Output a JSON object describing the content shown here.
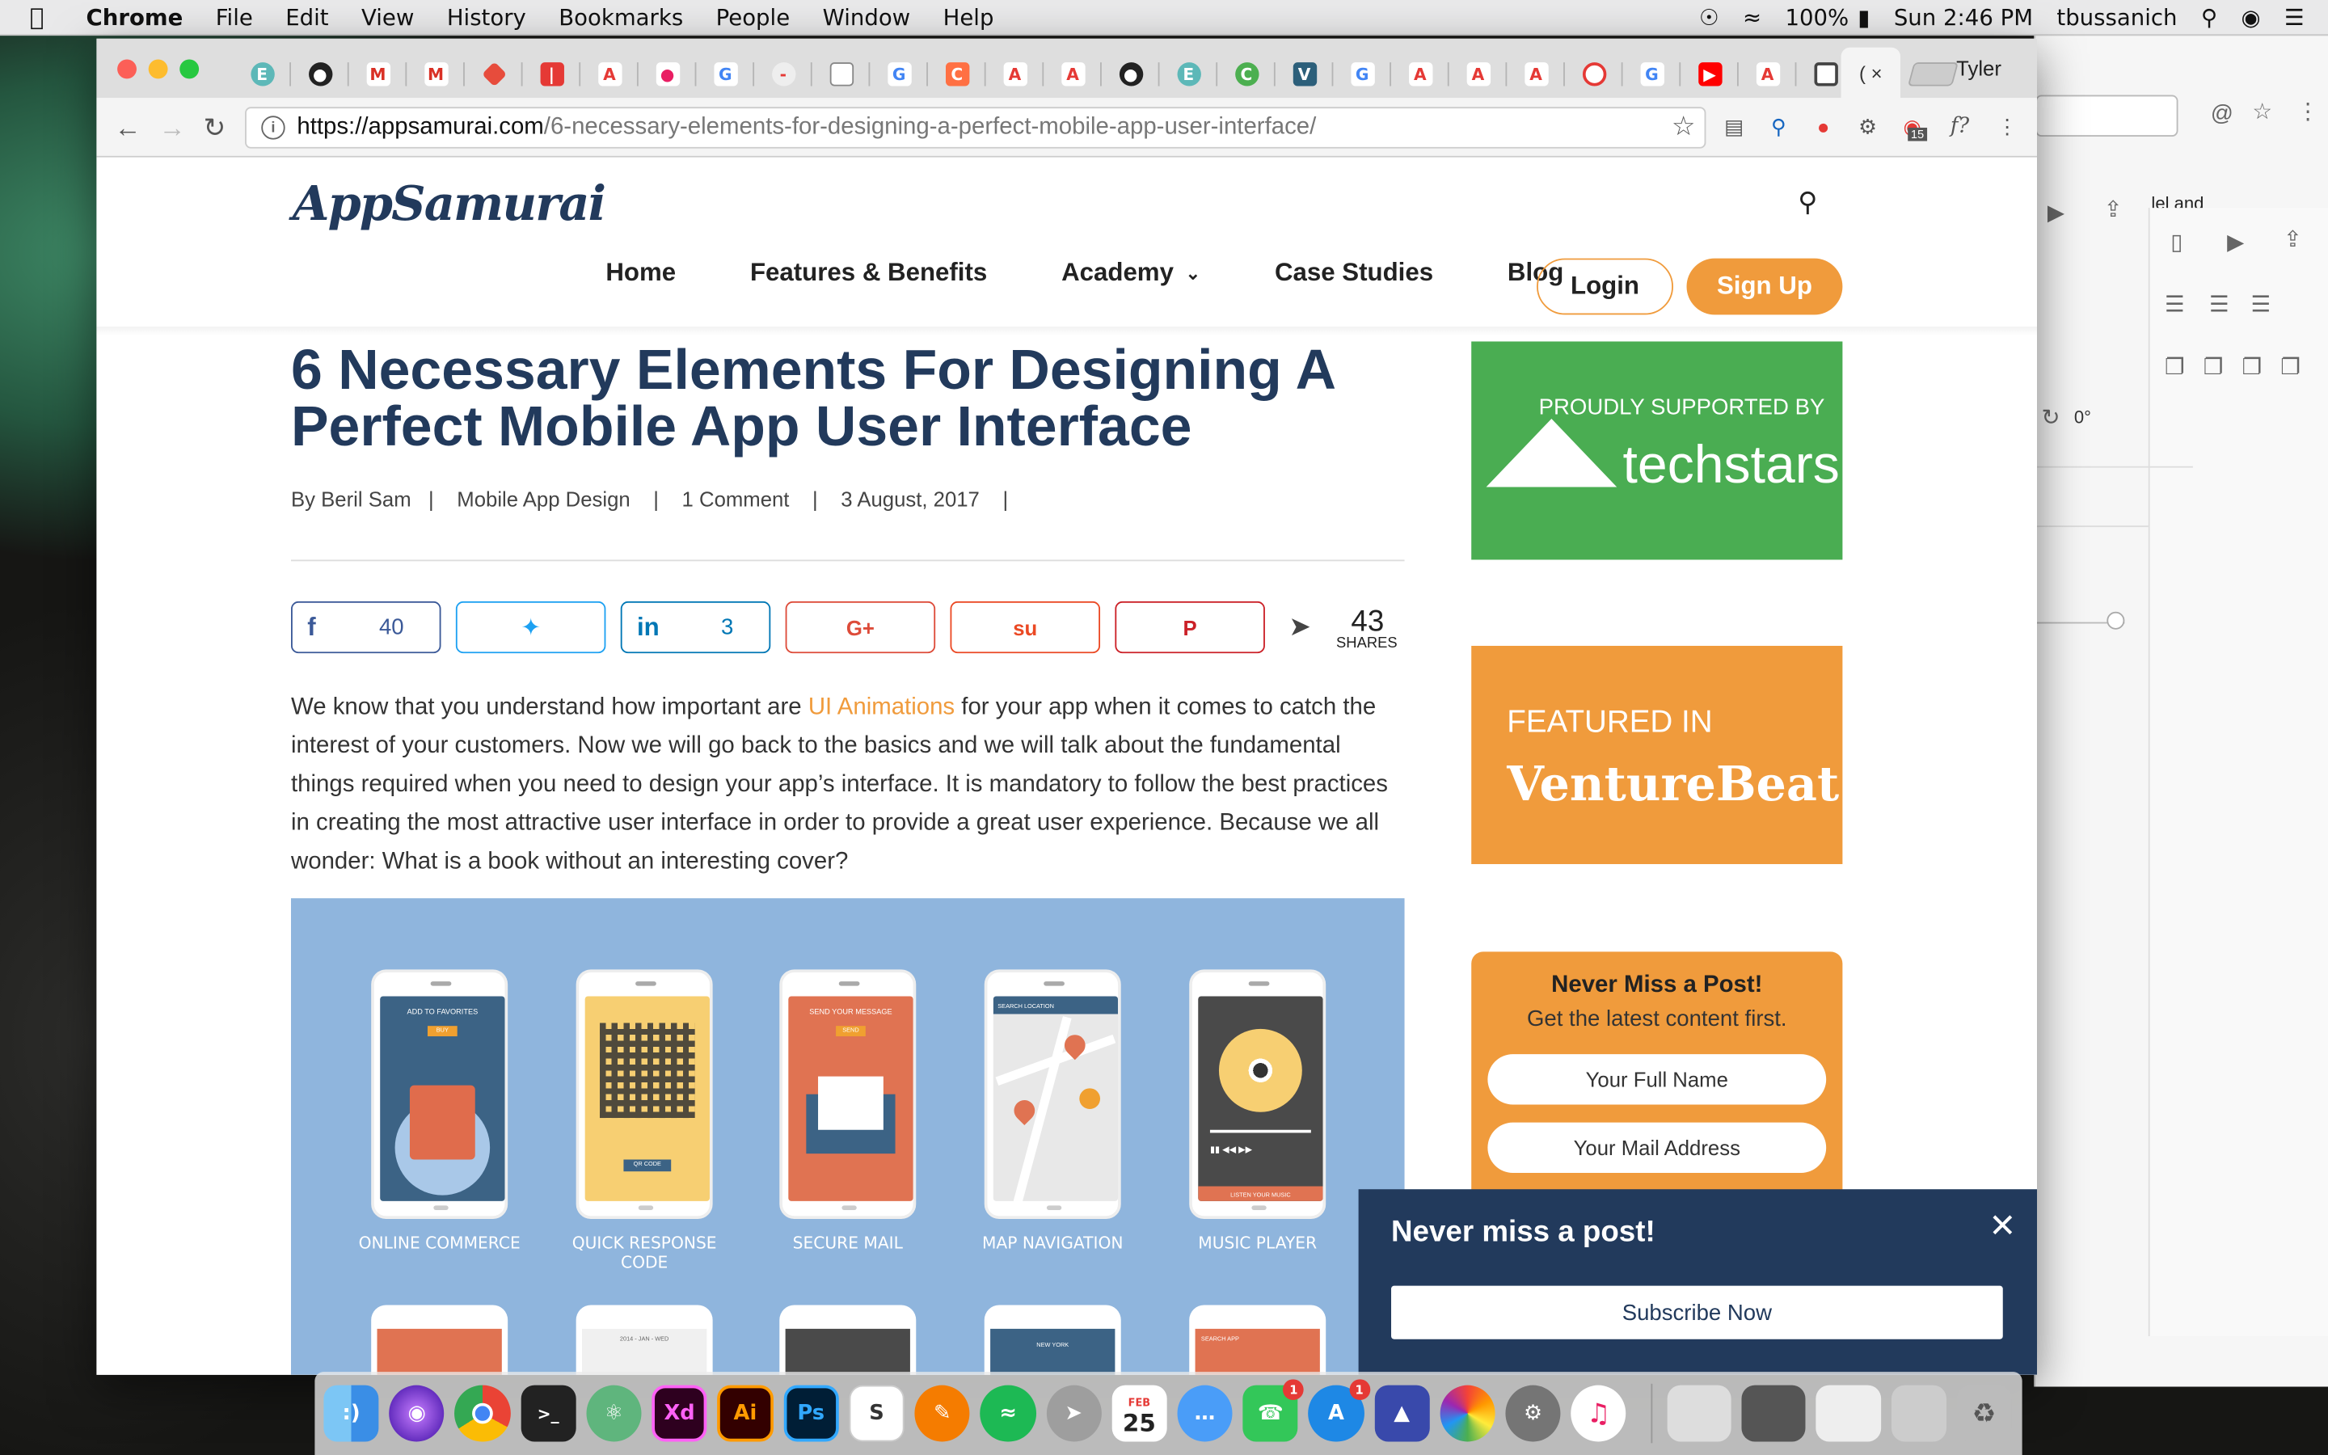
{
  "menubar": {
    "items": [
      "Chrome",
      "File",
      "Edit",
      "View",
      "History",
      "Bookmarks",
      "People",
      "Window",
      "Help"
    ],
    "battery": "100%",
    "clock": "Sun 2:46 PM",
    "user": "tbussanich"
  },
  "browser": {
    "profile": "Tyler",
    "url_host": "https://appsamurai.com",
    "url_path": "/6-necessary-elements-for-designing-a-perfect-mobile-app-user-interface/",
    "extension_badge": "15",
    "background_partial_text": "lel and",
    "background_rotation": "0°"
  },
  "site": {
    "logo": "AppSamurai",
    "nav": [
      "Home",
      "Features & Benefits",
      "Academy",
      "Case Studies",
      "Blog"
    ],
    "login": "Login",
    "signup": "Sign Up"
  },
  "article": {
    "title": "6 Necessary Elements For Designing A Perfect Mobile App User Interface",
    "meta": "By Beril Sam   |    Mobile App Design    |    1 Comment    |    3 August, 2017    |",
    "shares": {
      "facebook": "40",
      "linkedin": "3",
      "total": "43",
      "total_label": "SHARES"
    },
    "para_before_link": "We know that you understand how important are ",
    "link": "UI Animations",
    "para_after_link": " for your app when it comes to catch the interest of your customers. Now we will go back to the basics and we will talk about the fundamental things required when you need to design your app’s interface. It is mandatory to follow the best practices in creating the most attractive user interface in order to provide a great user experience. Because we all wonder: What is a book without an interesting cover?",
    "phones": [
      "ONLINE COMMERCE",
      "QUICK RESPONSE CODE",
      "SECURE MAIL",
      "MAP NAVIGATION",
      "MUSIC PLAYER"
    ],
    "phone_screen_text": [
      "ADD TO FAVORITES",
      "BUY",
      "QR CODE",
      "SEND YOUR MESSAGE",
      "SEND",
      "SEARCH LOCATION",
      "LISTEN YOUR MUSIC",
      "2014 - JAN - WED",
      "NEW YORK",
      "SEARCH APP"
    ]
  },
  "sidebar": {
    "techstars_label": "PROUDLY SUPPORTED BY",
    "techstars_logo": "techstars",
    "vb_label": "FEATURED IN",
    "vb_logo": "VentureBeat",
    "newsletter_title": "Never Miss a Post!",
    "newsletter_sub": "Get the latest content first.",
    "name_placeholder": "Your Full Name",
    "mail_placeholder": "Your Mail Address"
  },
  "popup": {
    "title": "Never miss a post!",
    "button": "Subscribe Now"
  },
  "dock": {
    "calendar_month": "FEB",
    "calendar_day": "25",
    "badges": [
      "1",
      "1"
    ]
  }
}
